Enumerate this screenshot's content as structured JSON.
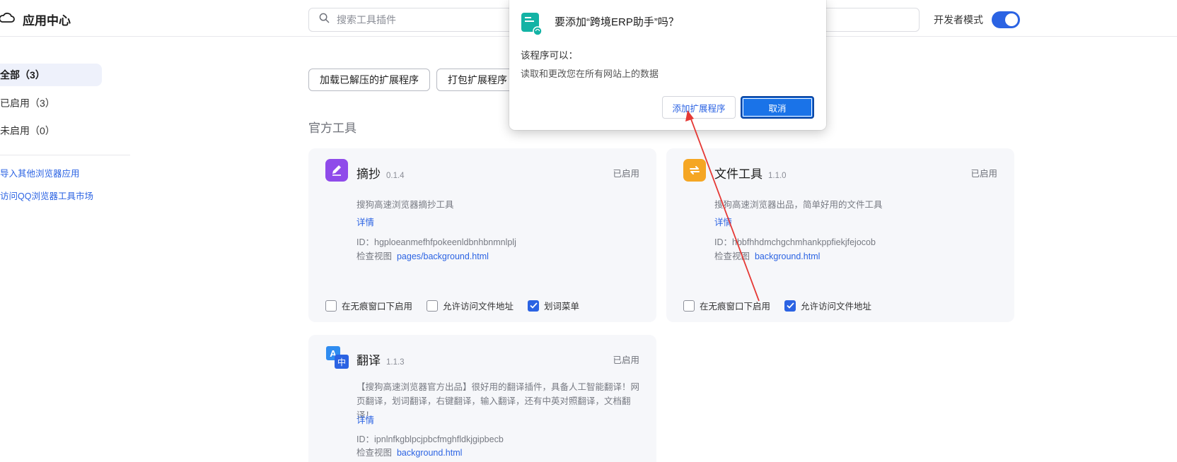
{
  "header": {
    "title": "应用中心",
    "search_placeholder": "搜索工具插件",
    "dev_mode_label": "开发者模式",
    "dev_mode_on": true
  },
  "sidebar": {
    "items": [
      {
        "label": "全部（3）",
        "active": true
      },
      {
        "label": "已启用（3）",
        "active": false
      },
      {
        "label": "未启用（0）",
        "active": false
      }
    ],
    "links": [
      "导入其他浏览器应用",
      "访问QQ浏览器工具市场"
    ]
  },
  "toolbar": {
    "load_unpacked": "加载已解压的扩展程序",
    "pack": "打包扩展程序"
  },
  "section_title": "官方工具",
  "extensions": [
    {
      "name": "摘抄",
      "version": "0.1.4",
      "status": "已启用",
      "description": "搜狗高速浏览器摘抄工具",
      "detail_label": "详情",
      "id_label": "ID：",
      "id": "hgploeanmefhfpokeenldbnhbnmnlplj",
      "inspect_label": "检查视图",
      "inspect_link": "pages/background.html",
      "icon": "pen-icon",
      "icon_color": "#8f4bea",
      "options": [
        {
          "label": "在无痕窗口下启用",
          "checked": false
        },
        {
          "label": "允许访问文件地址",
          "checked": false
        },
        {
          "label": "划词菜单",
          "checked": true
        }
      ]
    },
    {
      "name": "文件工具",
      "version": "1.1.0",
      "status": "已启用",
      "description": "搜狗高速浏览器出品，简单好用的文件工具",
      "detail_label": "详情",
      "id_label": "ID：",
      "id": "hbbfhhdmchgchmhankppfiekjfejocob",
      "inspect_label": "检查视图",
      "inspect_link": "background.html",
      "icon": "folder-icon",
      "icon_color": "#f5a623",
      "options": [
        {
          "label": "在无痕窗口下启用",
          "checked": false
        },
        {
          "label": "允许访问文件地址",
          "checked": true
        }
      ]
    },
    {
      "name": "翻译",
      "version": "1.1.3",
      "status": "已启用",
      "description": "【搜狗高速浏览器官方出品】很好用的翻译插件，具备人工智能翻译！网页翻译，划词翻译，右键翻译，输入翻译，还有中英对照翻译，文档翻译！",
      "detail_label": "详情",
      "id_label": "ID：",
      "id": "ipnlnfkgblpcjpbcfmghfldkjgipbecb",
      "inspect_label": "检查视图",
      "inspect_link": "background.html",
      "icon": "translate-icon",
      "icon_color": "#2b63e3"
    }
  ],
  "dialog": {
    "title": "要添加“跨境ERP助手”吗？",
    "subtitle": "该程序可以：",
    "permission": "读取和更改您在所有网站上的数据",
    "add_button": "添加扩展程序",
    "cancel_button": "取消",
    "icon": "extension-icon",
    "icon_color": "#13b3a5"
  },
  "colors": {
    "accent": "#2b63e3",
    "annotation_arrow": "#e53935"
  }
}
